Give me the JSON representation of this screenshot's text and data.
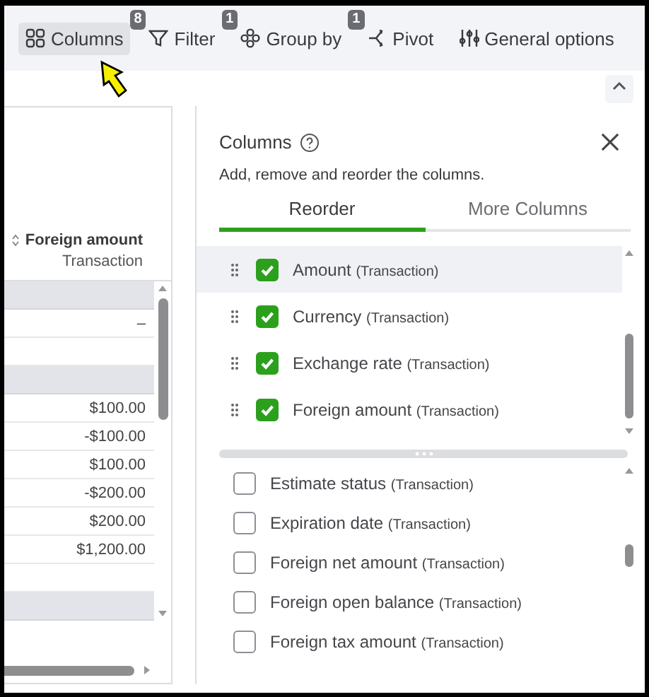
{
  "toolbar": [
    {
      "label": "Columns",
      "badge": "8",
      "selected": true
    },
    {
      "label": "Filter",
      "badge": "1",
      "selected": false
    },
    {
      "label": "Group by",
      "badge": "1",
      "selected": false
    },
    {
      "label": "Pivot",
      "selected": false
    },
    {
      "label": "General options",
      "selected": false
    }
  ],
  "table": {
    "column": {
      "title": "Foreign amount",
      "subtitle": "Transaction"
    },
    "rows": [
      {
        "shaded": true
      },
      {
        "value": "–",
        "shaded": false
      },
      {
        "shaded": false
      },
      {
        "shaded": true
      },
      {
        "value": "$100.00",
        "shaded": false
      },
      {
        "value": "-$100.00",
        "shaded": false
      },
      {
        "value": "$100.00",
        "shaded": false
      },
      {
        "value": "-$200.00",
        "shaded": false
      },
      {
        "value": "$200.00",
        "shaded": false
      },
      {
        "value": "$1,200.00",
        "shaded": false
      },
      {
        "shaded": false
      },
      {
        "shaded": true
      }
    ]
  },
  "panel": {
    "title": "Columns",
    "description": "Add, remove and reorder the columns.",
    "tabs": [
      {
        "label": "Reorder",
        "selected": true
      },
      {
        "label": "More Columns",
        "selected": false
      }
    ],
    "selected_columns": [
      {
        "name": "Amount",
        "source": "(Transaction)",
        "checked": true,
        "highlighted": true
      },
      {
        "name": "Currency",
        "source": "(Transaction)",
        "checked": true,
        "highlighted": false
      },
      {
        "name": "Exchange rate",
        "source": "(Transaction)",
        "checked": true,
        "highlighted": false
      },
      {
        "name": "Foreign amount",
        "source": "(Transaction)",
        "checked": true,
        "highlighted": false
      }
    ],
    "available_columns": [
      {
        "name": "Estimate status",
        "source": "(Transaction)",
        "checked": false
      },
      {
        "name": "Expiration date",
        "source": "(Transaction)",
        "checked": false
      },
      {
        "name": "Foreign net amount",
        "source": "(Transaction)",
        "checked": false
      },
      {
        "name": "Foreign open balance",
        "source": "(Transaction)",
        "checked": false
      },
      {
        "name": "Foreign tax amount",
        "source": "(Transaction)",
        "checked": false
      }
    ]
  }
}
